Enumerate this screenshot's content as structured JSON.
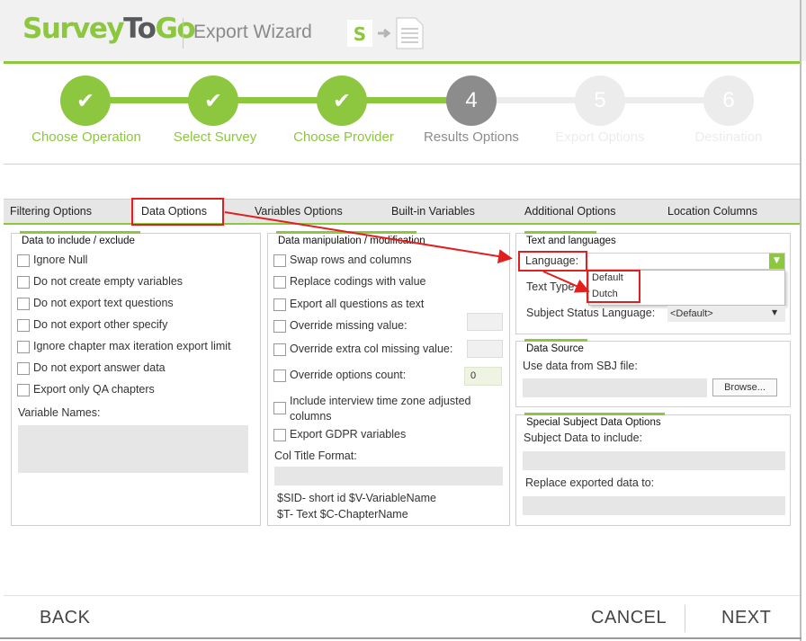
{
  "header": {
    "logo_part1": "Survey",
    "logo_part2": "To",
    "logo_part3": "Go",
    "title": "Export Wizard",
    "export_icon_letter": "S"
  },
  "colors": {
    "accent": "#8dc63f",
    "step_current": "#8c8c8c",
    "step_future": "#ececec",
    "annotation": "#e21f1f"
  },
  "steps": [
    {
      "label": "Choose Operation",
      "mark": "✔",
      "state": "done"
    },
    {
      "label": "Select Survey",
      "mark": "✔",
      "state": "done"
    },
    {
      "label": "Choose Provider",
      "mark": "✔",
      "state": "done"
    },
    {
      "label": "Results Options",
      "mark": "4",
      "state": "current"
    },
    {
      "label": "Export Options",
      "mark": "5",
      "state": "future"
    },
    {
      "label": "Destination",
      "mark": "6",
      "state": "future"
    }
  ],
  "tabs": {
    "filtering": "Filtering Options",
    "data": "Data Options",
    "variables": "Variables Options",
    "builtin": "Built-in Variables",
    "additional": "Additional Options",
    "location": "Location Columns"
  },
  "include_exclude": {
    "title": "Data to include / exclude",
    "items": [
      "Ignore Null",
      "Do not create empty variables",
      "Do not export text questions",
      "Do not export other specify",
      "Ignore chapter max iteration export limit",
      "Do not export answer data",
      "Export only QA chapters"
    ],
    "variable_names_label": "Variable Names:"
  },
  "manipulation": {
    "title": "Data manipulation / modification",
    "items": [
      "Swap rows and columns",
      "Replace codings with value",
      "Export all questions as text",
      "Override missing value:",
      "Override extra col missing value:",
      "Override options count:",
      "Include interview time zone adjusted columns",
      "Export GDPR variables"
    ],
    "options_count_value": "0",
    "col_title_label": "Col Title Format:",
    "hint_line1": "$SID- short id  $V-VariableName",
    "hint_line2": "$T- Text  $C-ChapterName"
  },
  "text_languages": {
    "title": "Text and languages",
    "language_label": "Language:",
    "text_type_label": "Text Type",
    "dropdown_options": [
      "Default",
      "Dutch"
    ],
    "subject_status_label": "Subject Status Language:",
    "subject_status_value": "<Default>"
  },
  "data_source": {
    "title": "Data Source",
    "label": "Use data from SBJ file:",
    "browse": "Browse..."
  },
  "special_subject": {
    "title": "Special Subject Data Options",
    "include_label": "Subject Data to include:",
    "replace_label": "Replace exported data to:"
  },
  "nav": {
    "back": "BACK",
    "cancel": "CANCEL",
    "next": "NEXT"
  }
}
